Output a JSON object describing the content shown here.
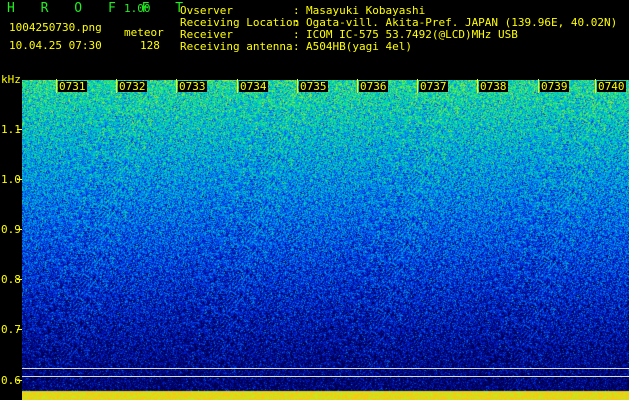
{
  "app": {
    "title": "H R O F F T",
    "version": "1.00"
  },
  "file": {
    "name": "1004250730.png",
    "timestamp": "10.04.25 07:30"
  },
  "meteor": {
    "label": "meteor",
    "count": "128"
  },
  "info": [
    {
      "label": "Ovserver",
      "value": "Masayuki Kobayashi"
    },
    {
      "label": "Receiving Location",
      "value": "Ogata-vill. Akita-Pref. JAPAN (139.96E, 40.02N)"
    },
    {
      "label": "Receiver",
      "value": "ICOM IC-575 53.7492(@LCD)MHz USB"
    },
    {
      "label": "Receiving antenna",
      "value": "A504HB(yagi 4el)"
    }
  ],
  "separator": ":",
  "axis": {
    "y_unit": "kHz",
    "y_ticks": [
      "1.1",
      "1.0",
      "0.9",
      "0.8",
      "0.7",
      "0.6"
    ],
    "time_ticks": [
      "0731",
      "0732",
      "0733",
      "0734",
      "0735",
      "0736",
      "0737",
      "0738",
      "0739",
      "0740"
    ]
  },
  "colors": {
    "text": "#ffff00",
    "title": "#22ee22",
    "background": "#000000"
  }
}
